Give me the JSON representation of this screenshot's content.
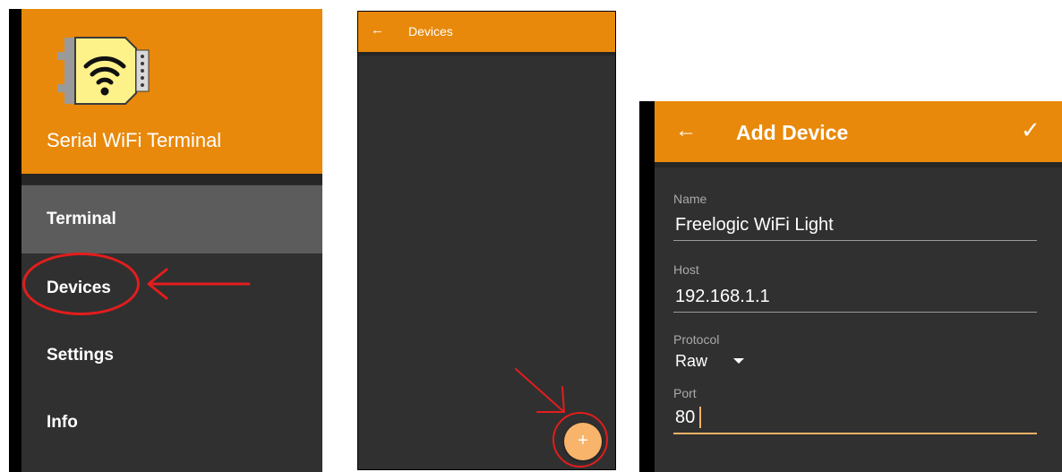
{
  "drawer": {
    "app_title": "Serial WiFi Terminal",
    "items": [
      {
        "label": "Terminal",
        "active": true
      },
      {
        "label": "Devices",
        "active": false
      },
      {
        "label": "Settings",
        "active": false
      },
      {
        "label": "Info",
        "active": false
      }
    ],
    "header_color": "#e8890c",
    "logo_icon": "serial-wifi-connector-logo"
  },
  "devices_screen": {
    "title": "Devices",
    "back_icon": "arrow-left-icon",
    "fab_label": "+",
    "fab_color": "#f9b46b"
  },
  "add_device": {
    "title": "Add Device",
    "back_icon": "arrow-left-icon",
    "confirm_icon": "check-icon",
    "fields": {
      "name": {
        "label": "Name",
        "value": "Freelogic WiFi Light"
      },
      "host": {
        "label": "Host",
        "value": "192.168.1.1"
      },
      "protocol": {
        "label": "Protocol",
        "value": "Raw"
      },
      "port": {
        "label": "Port",
        "value": "80"
      }
    }
  },
  "annotations": {
    "color": "#e21d1d"
  }
}
